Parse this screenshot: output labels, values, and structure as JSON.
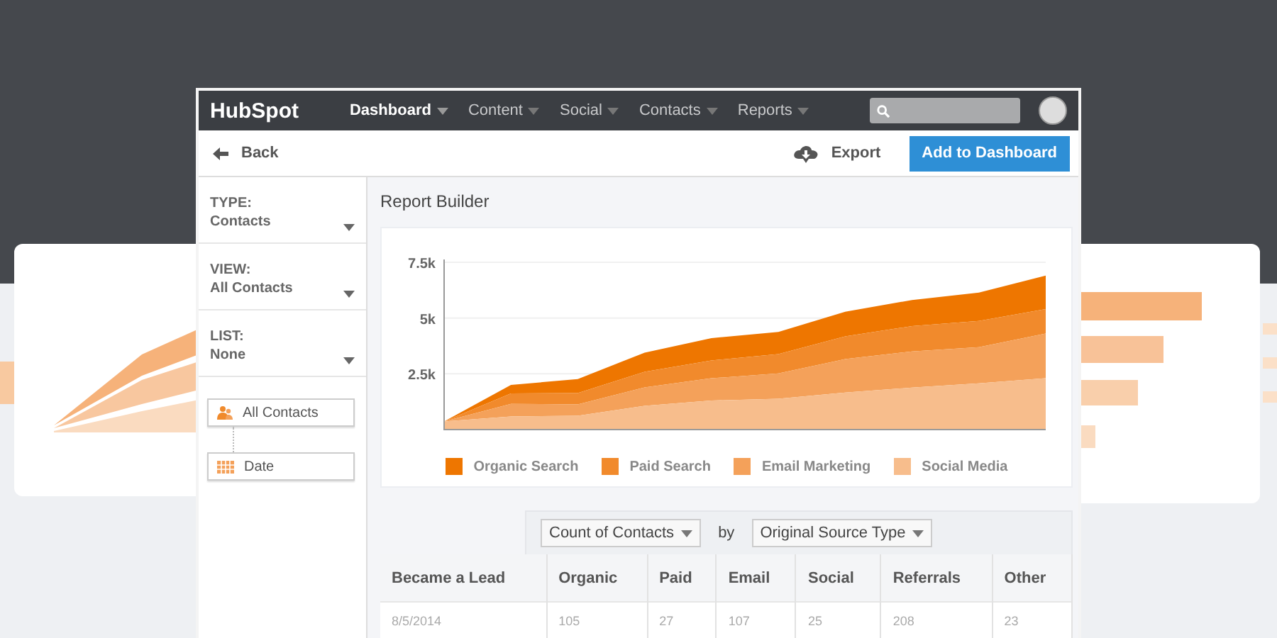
{
  "nav": {
    "logo": "HubSpot",
    "items": [
      {
        "label": "Dashboard",
        "selected": true
      },
      {
        "label": "Content",
        "selected": false
      },
      {
        "label": "Social",
        "selected": false
      },
      {
        "label": "Contacts",
        "selected": false
      },
      {
        "label": "Reports",
        "selected": false
      }
    ]
  },
  "toolbar": {
    "back": "Back",
    "export": "Export",
    "primary_button": "Add to Dashboard"
  },
  "sidebar": {
    "filters": [
      {
        "label": "TYPE:",
        "value": "Contacts"
      },
      {
        "label": "VIEW:",
        "value": "All Contacts"
      },
      {
        "label": "LIST:",
        "value": "None"
      }
    ],
    "nodes": [
      {
        "kind": "contacts",
        "label": "All Contacts"
      },
      {
        "kind": "date",
        "label": "Date"
      }
    ]
  },
  "report": {
    "title": "Report Builder",
    "chart_data": {
      "type": "area",
      "stacked": true,
      "categories": [
        null,
        null,
        null,
        null,
        null,
        null,
        null,
        null,
        null,
        null
      ],
      "ylim": [
        0,
        7500
      ],
      "yticks": [
        {
          "value": 2500,
          "label": "2.5k"
        },
        {
          "value": 5000,
          "label": "5k"
        },
        {
          "value": 7500,
          "label": "7.5k"
        }
      ],
      "series": [
        {
          "name": "Organic Search",
          "color": "#ee7600",
          "values": [
            0,
            380,
            620,
            860,
            1000,
            1000,
            1100,
            1170,
            1270,
            1500
          ]
        },
        {
          "name": "Paid Search",
          "color": "#f18a2c",
          "values": [
            0,
            470,
            510,
            700,
            800,
            860,
            1020,
            1140,
            1180,
            1100
          ]
        },
        {
          "name": "Email Marketing",
          "color": "#f4a15a",
          "values": [
            0,
            560,
            510,
            830,
            1000,
            1140,
            1500,
            1620,
            1620,
            2000
          ]
        },
        {
          "name": "Social Media",
          "color": "#f7bd8c",
          "values": [
            360,
            590,
            620,
            1060,
            1300,
            1380,
            1660,
            1880,
            2070,
            2300
          ]
        }
      ]
    }
  },
  "table": {
    "measure": "Count of Contacts",
    "by": "by",
    "dimension": "Original Source Type",
    "columns": [
      "Became a Lead",
      "Organic",
      "Paid",
      "Email",
      "Social",
      "Referrals",
      "Other"
    ],
    "rows": [
      [
        "8/5/2014",
        "105",
        "27",
        "107",
        "25",
        "208",
        "23"
      ]
    ]
  }
}
